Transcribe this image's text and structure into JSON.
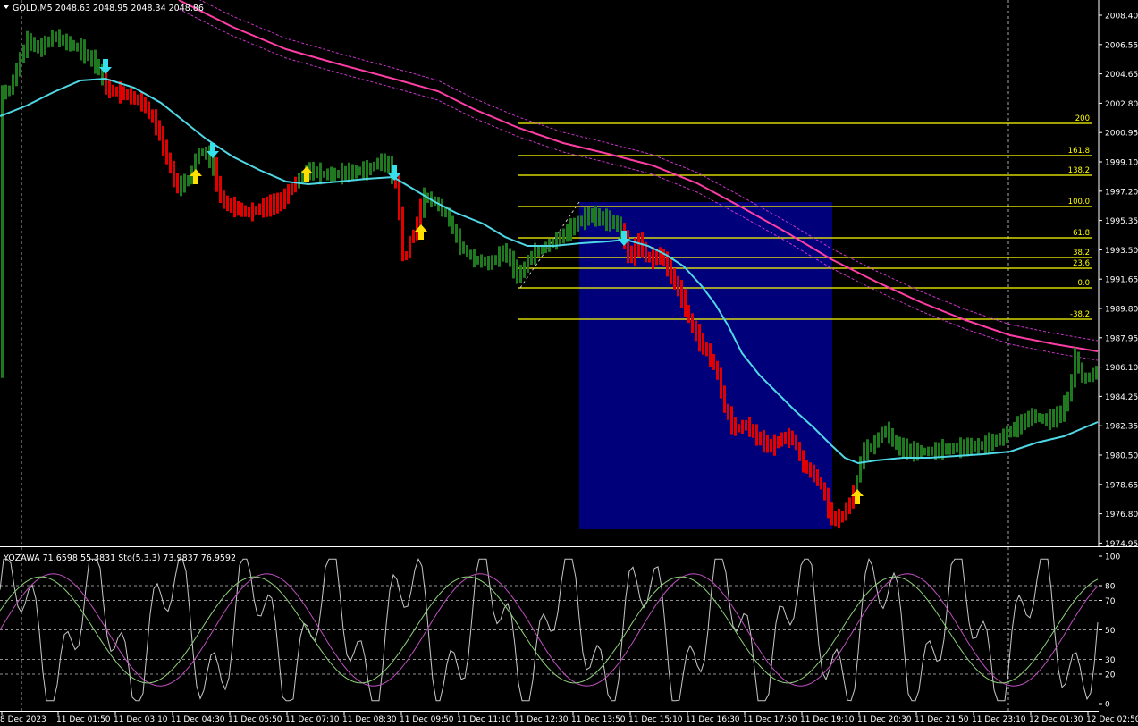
{
  "main_panel": {
    "symbol_info": "GOLD,M5  2048.63 2048.95 2048.34 2048.86",
    "price_labels": [
      "2008.40",
      "2006.55",
      "2004.65",
      "2002.80",
      "2000.95",
      "1999.10",
      "1997.20",
      "1995.35",
      "1993.50",
      "1991.65",
      "1989.80",
      "1987.95",
      "1986.10",
      "1984.25",
      "1982.35",
      "1980.50",
      "1978.65",
      "1976.80",
      "1974.95"
    ],
    "fib_levels": [
      "200",
      "161.8",
      "138.2",
      "100.0",
      "61.8",
      "38.2",
      "23.6",
      "0.0",
      "-38.2"
    ]
  },
  "sub_panel": {
    "indicator_info": "YOZAWA 71.6598 55.3831  Sto(5,3,3) 73.9837 76.9592",
    "scale_labels": [
      "100",
      "80",
      "70",
      "50",
      "30",
      "20",
      "0"
    ]
  },
  "time_labels": [
    "8 Dec 2023",
    "11 Dec 01:50",
    "11 Dec 03:10",
    "11 Dec 04:30",
    "11 Dec 05:50",
    "11 Dec 07:10",
    "11 Dec 08:30",
    "11 Dec 09:50",
    "11 Dec 11:10",
    "11 Dec 12:30",
    "11 Dec 13:50",
    "11 Dec 15:10",
    "11 Dec 16:30",
    "11 Dec 17:50",
    "11 Dec 19:10",
    "11 Dec 20:30",
    "11 Dec 21:50",
    "11 Dec 23:10",
    "12 Dec 01:30",
    "12 Dec 02:50"
  ],
  "colors": {
    "background": "#000000",
    "bull": "#1f7a1f",
    "bear": "#e00000",
    "ma_fast": "#4fd8e6",
    "ma_slow": "#ff3ea5",
    "fib": "#ffff00",
    "rectangle": "#00007a",
    "grid": "#c0c0c0"
  },
  "icons": {
    "buy_signal": "yellow-up-arrow-icon",
    "sell_signal": "cyan-down-arrow-icon",
    "symbol_menu": "triangle-down-icon"
  }
}
